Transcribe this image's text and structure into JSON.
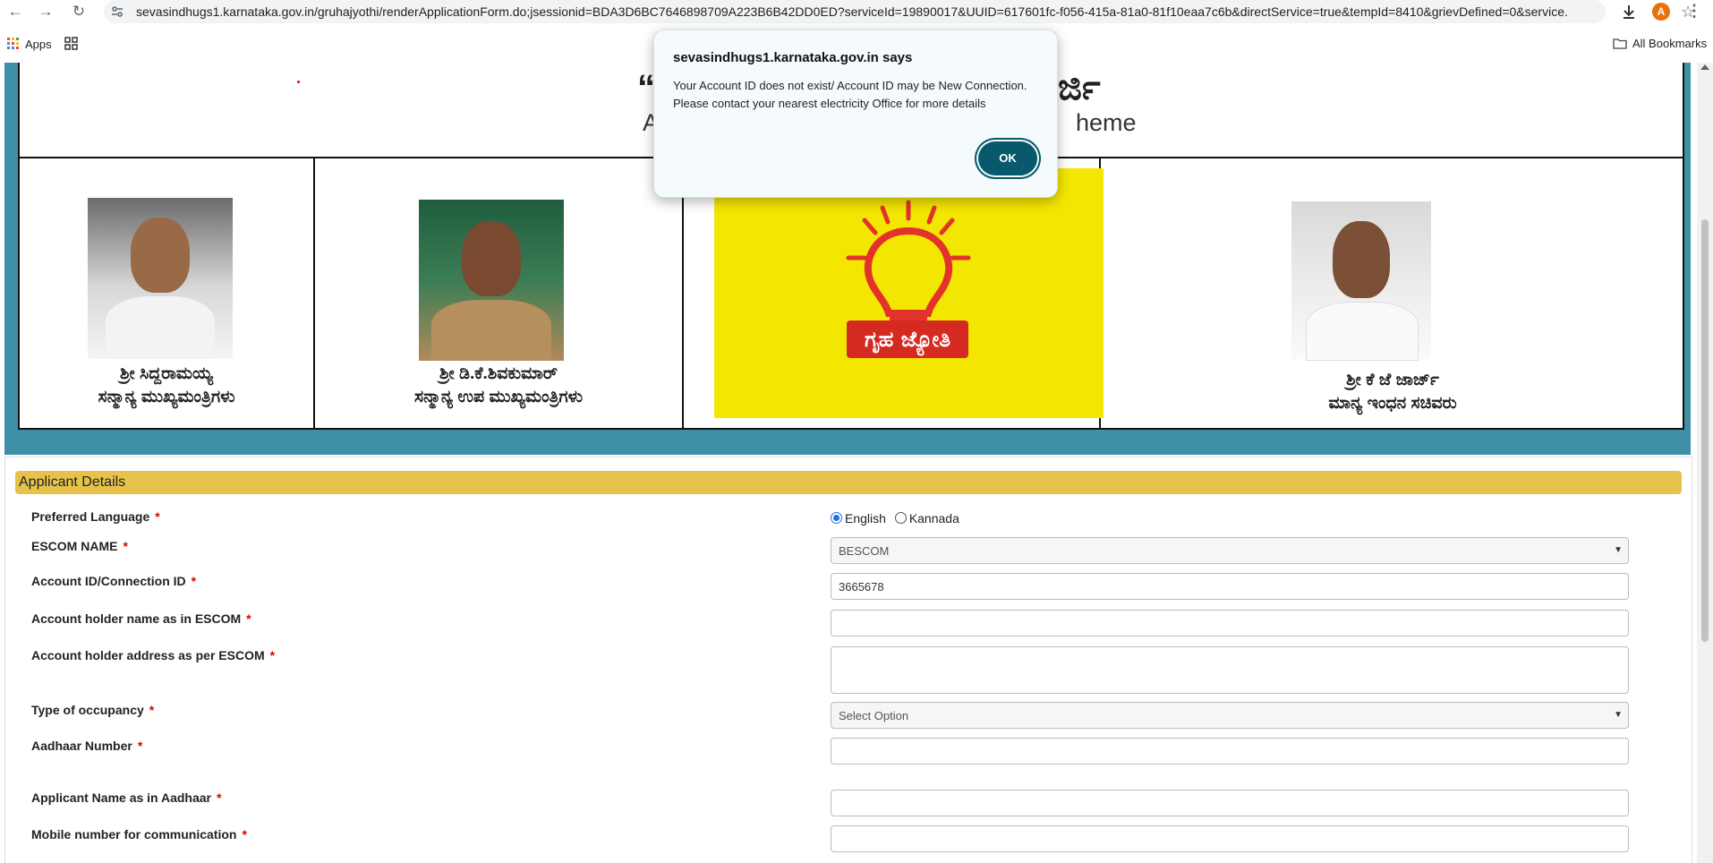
{
  "browser": {
    "url": "sevasindhugs1.karnataka.gov.in/gruhajyothi/renderApplicationForm.do;jsessionid=BDA3D6BC7646898709A223B6B42DD0ED?serviceId=19890017&UUID=617601fc-f056-415a-81a0-81f10eaa7c6b&directService=true&tempId=8410&grievDefined=0&service...",
    "profile_initial": "A",
    "apps_label": "Apps",
    "all_bookmarks": "All Bookmarks"
  },
  "banner": {
    "title_left": "“ಗ",
    "title_right": "ರ್ಜಿ",
    "subtitle_left": "Ap",
    "subtitle_right": "heme",
    "people": [
      {
        "name": "ಶ್ರೀ ಸಿದ್ದರಾಮಯ್ಯ",
        "role": "ಸನ್ಮಾನ್ಯ ಮುಖ್ಯಮಂತ್ರಿಗಳು"
      },
      {
        "name": "ಶ್ರೀ ಡಿ.ಕೆ.ಶಿವಕುಮಾರ್",
        "role": "ಸನ್ಮಾನ್ಯ ಉಪ ಮುಖ್ಯಮಂತ್ರಿಗಳು"
      },
      {
        "name": "ಶ್ರೀ ಕೆ ಜೆ ಜಾರ್ಜ್",
        "role": "ಮಾನ್ಯ ಇಂಧನ ಸಚಿವರು"
      }
    ],
    "logo_text": "ಗೃಹ ಜ್ಯೋತಿ"
  },
  "form": {
    "section_title": "Applicant Details",
    "preferred_language_label": "Preferred Language",
    "lang_english": "English",
    "lang_kannada": "Kannada",
    "escom_label": "ESCOM NAME",
    "escom_value": "BESCOM",
    "account_id_label": "Account ID/Connection ID",
    "account_id_value": "3665678",
    "holder_name_label": "Account holder name as in ESCOM",
    "holder_address_label": "Account holder address as per ESCOM",
    "occupancy_label": "Type of occupancy",
    "occupancy_value": "Select Option",
    "aadhaar_label": "Aadhaar Number",
    "applicant_name_label": "Applicant Name as in Aadhaar",
    "mobile_label": "Mobile number for communication",
    "required_mark": "*"
  },
  "dialog": {
    "title": "sevasindhugs1.karnataka.gov.in says",
    "message_line1": "Your Account ID does not exist/ Account ID may be New Connection.",
    "message_line2": "Please contact your nearest electricity Office for more details",
    "ok_label": "OK"
  },
  "colors": {
    "banner_bg": "#3f8fa6",
    "section_bar": "#e6c24a",
    "ok_button": "#07596b",
    "logo_bg": "#f3e600"
  }
}
